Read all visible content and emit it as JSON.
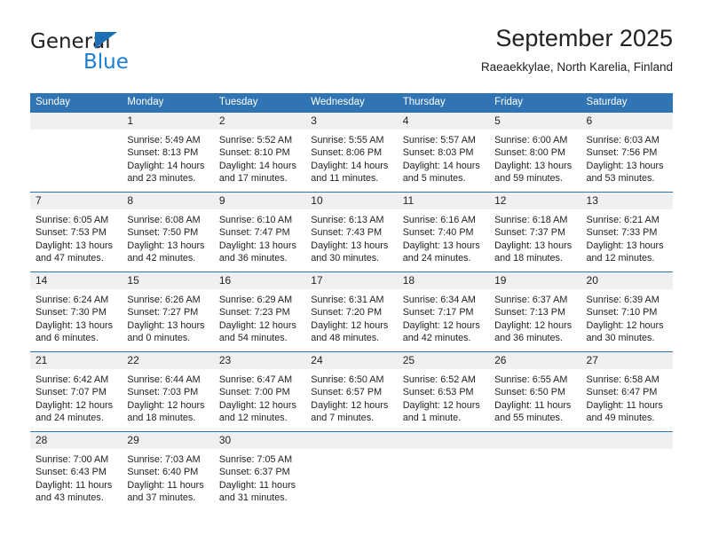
{
  "brand": {
    "name_top": "General",
    "name_bottom": "Blue",
    "accent_color": "#1b7fd4",
    "triangle_color": "#1f6fb5"
  },
  "header": {
    "title": "September 2025",
    "subtitle": "Raeaekkylae, North Karelia, Finland"
  },
  "calendar": {
    "header_bg": "#3174b4",
    "daynum_bg": "#f0f0f0",
    "weekday_names": [
      "Sunday",
      "Monday",
      "Tuesday",
      "Wednesday",
      "Thursday",
      "Friday",
      "Saturday"
    ],
    "weeks": [
      [
        {
          "day": "",
          "lines": []
        },
        {
          "day": "1",
          "lines": [
            "Sunrise: 5:49 AM",
            "Sunset: 8:13 PM",
            "Daylight: 14 hours",
            "and 23 minutes."
          ]
        },
        {
          "day": "2",
          "lines": [
            "Sunrise: 5:52 AM",
            "Sunset: 8:10 PM",
            "Daylight: 14 hours",
            "and 17 minutes."
          ]
        },
        {
          "day": "3",
          "lines": [
            "Sunrise: 5:55 AM",
            "Sunset: 8:06 PM",
            "Daylight: 14 hours",
            "and 11 minutes."
          ]
        },
        {
          "day": "4",
          "lines": [
            "Sunrise: 5:57 AM",
            "Sunset: 8:03 PM",
            "Daylight: 14 hours",
            "and 5 minutes."
          ]
        },
        {
          "day": "5",
          "lines": [
            "Sunrise: 6:00 AM",
            "Sunset: 8:00 PM",
            "Daylight: 13 hours",
            "and 59 minutes."
          ]
        },
        {
          "day": "6",
          "lines": [
            "Sunrise: 6:03 AM",
            "Sunset: 7:56 PM",
            "Daylight: 13 hours",
            "and 53 minutes."
          ]
        }
      ],
      [
        {
          "day": "7",
          "lines": [
            "Sunrise: 6:05 AM",
            "Sunset: 7:53 PM",
            "Daylight: 13 hours",
            "and 47 minutes."
          ]
        },
        {
          "day": "8",
          "lines": [
            "Sunrise: 6:08 AM",
            "Sunset: 7:50 PM",
            "Daylight: 13 hours",
            "and 42 minutes."
          ]
        },
        {
          "day": "9",
          "lines": [
            "Sunrise: 6:10 AM",
            "Sunset: 7:47 PM",
            "Daylight: 13 hours",
            "and 36 minutes."
          ]
        },
        {
          "day": "10",
          "lines": [
            "Sunrise: 6:13 AM",
            "Sunset: 7:43 PM",
            "Daylight: 13 hours",
            "and 30 minutes."
          ]
        },
        {
          "day": "11",
          "lines": [
            "Sunrise: 6:16 AM",
            "Sunset: 7:40 PM",
            "Daylight: 13 hours",
            "and 24 minutes."
          ]
        },
        {
          "day": "12",
          "lines": [
            "Sunrise: 6:18 AM",
            "Sunset: 7:37 PM",
            "Daylight: 13 hours",
            "and 18 minutes."
          ]
        },
        {
          "day": "13",
          "lines": [
            "Sunrise: 6:21 AM",
            "Sunset: 7:33 PM",
            "Daylight: 13 hours",
            "and 12 minutes."
          ]
        }
      ],
      [
        {
          "day": "14",
          "lines": [
            "Sunrise: 6:24 AM",
            "Sunset: 7:30 PM",
            "Daylight: 13 hours",
            "and 6 minutes."
          ]
        },
        {
          "day": "15",
          "lines": [
            "Sunrise: 6:26 AM",
            "Sunset: 7:27 PM",
            "Daylight: 13 hours",
            "and 0 minutes."
          ]
        },
        {
          "day": "16",
          "lines": [
            "Sunrise: 6:29 AM",
            "Sunset: 7:23 PM",
            "Daylight: 12 hours",
            "and 54 minutes."
          ]
        },
        {
          "day": "17",
          "lines": [
            "Sunrise: 6:31 AM",
            "Sunset: 7:20 PM",
            "Daylight: 12 hours",
            "and 48 minutes."
          ]
        },
        {
          "day": "18",
          "lines": [
            "Sunrise: 6:34 AM",
            "Sunset: 7:17 PM",
            "Daylight: 12 hours",
            "and 42 minutes."
          ]
        },
        {
          "day": "19",
          "lines": [
            "Sunrise: 6:37 AM",
            "Sunset: 7:13 PM",
            "Daylight: 12 hours",
            "and 36 minutes."
          ]
        },
        {
          "day": "20",
          "lines": [
            "Sunrise: 6:39 AM",
            "Sunset: 7:10 PM",
            "Daylight: 12 hours",
            "and 30 minutes."
          ]
        }
      ],
      [
        {
          "day": "21",
          "lines": [
            "Sunrise: 6:42 AM",
            "Sunset: 7:07 PM",
            "Daylight: 12 hours",
            "and 24 minutes."
          ]
        },
        {
          "day": "22",
          "lines": [
            "Sunrise: 6:44 AM",
            "Sunset: 7:03 PM",
            "Daylight: 12 hours",
            "and 18 minutes."
          ]
        },
        {
          "day": "23",
          "lines": [
            "Sunrise: 6:47 AM",
            "Sunset: 7:00 PM",
            "Daylight: 12 hours",
            "and 12 minutes."
          ]
        },
        {
          "day": "24",
          "lines": [
            "Sunrise: 6:50 AM",
            "Sunset: 6:57 PM",
            "Daylight: 12 hours",
            "and 7 minutes."
          ]
        },
        {
          "day": "25",
          "lines": [
            "Sunrise: 6:52 AM",
            "Sunset: 6:53 PM",
            "Daylight: 12 hours",
            "and 1 minute."
          ]
        },
        {
          "day": "26",
          "lines": [
            "Sunrise: 6:55 AM",
            "Sunset: 6:50 PM",
            "Daylight: 11 hours",
            "and 55 minutes."
          ]
        },
        {
          "day": "27",
          "lines": [
            "Sunrise: 6:58 AM",
            "Sunset: 6:47 PM",
            "Daylight: 11 hours",
            "and 49 minutes."
          ]
        }
      ],
      [
        {
          "day": "28",
          "lines": [
            "Sunrise: 7:00 AM",
            "Sunset: 6:43 PM",
            "Daylight: 11 hours",
            "and 43 minutes."
          ]
        },
        {
          "day": "29",
          "lines": [
            "Sunrise: 7:03 AM",
            "Sunset: 6:40 PM",
            "Daylight: 11 hours",
            "and 37 minutes."
          ]
        },
        {
          "day": "30",
          "lines": [
            "Sunrise: 7:05 AM",
            "Sunset: 6:37 PM",
            "Daylight: 11 hours",
            "and 31 minutes."
          ]
        },
        {
          "day": "",
          "lines": []
        },
        {
          "day": "",
          "lines": []
        },
        {
          "day": "",
          "lines": []
        },
        {
          "day": "",
          "lines": []
        }
      ]
    ]
  }
}
